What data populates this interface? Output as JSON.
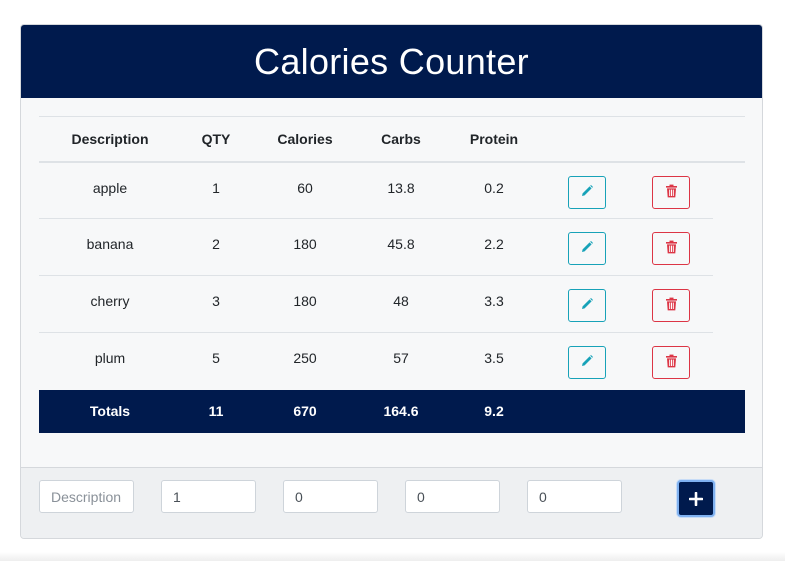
{
  "header": {
    "title": "Calories Counter"
  },
  "table": {
    "columns": [
      "Description",
      "QTY",
      "Calories",
      "Carbs",
      "Protein"
    ],
    "rows": [
      {
        "description": "apple",
        "qty": "1",
        "calories": "60",
        "carbs": "13.8",
        "protein": "0.2"
      },
      {
        "description": "banana",
        "qty": "2",
        "calories": "180",
        "carbs": "45.8",
        "protein": "2.2"
      },
      {
        "description": "cherry",
        "qty": "3",
        "calories": "180",
        "carbs": "48",
        "protein": "3.3"
      },
      {
        "description": "plum",
        "qty": "5",
        "calories": "250",
        "carbs": "57",
        "protein": "3.5"
      }
    ],
    "totals": {
      "label": "Totals",
      "qty": "11",
      "calories": "670",
      "carbs": "164.6",
      "protein": "9.2"
    }
  },
  "form": {
    "description": {
      "placeholder": "Description",
      "value": ""
    },
    "qty": {
      "value": "1"
    },
    "calories": {
      "value": "0"
    },
    "carbs": {
      "value": "0"
    },
    "protein": {
      "value": "0"
    },
    "add_icon": "plus-icon"
  },
  "icons": {
    "edit": "pencil-icon",
    "delete": "trash-icon"
  },
  "colors": {
    "navy": "#001a4d",
    "edit": "#17a2b8",
    "delete": "#dc3545",
    "focus_ring": "#7fb1f0"
  }
}
